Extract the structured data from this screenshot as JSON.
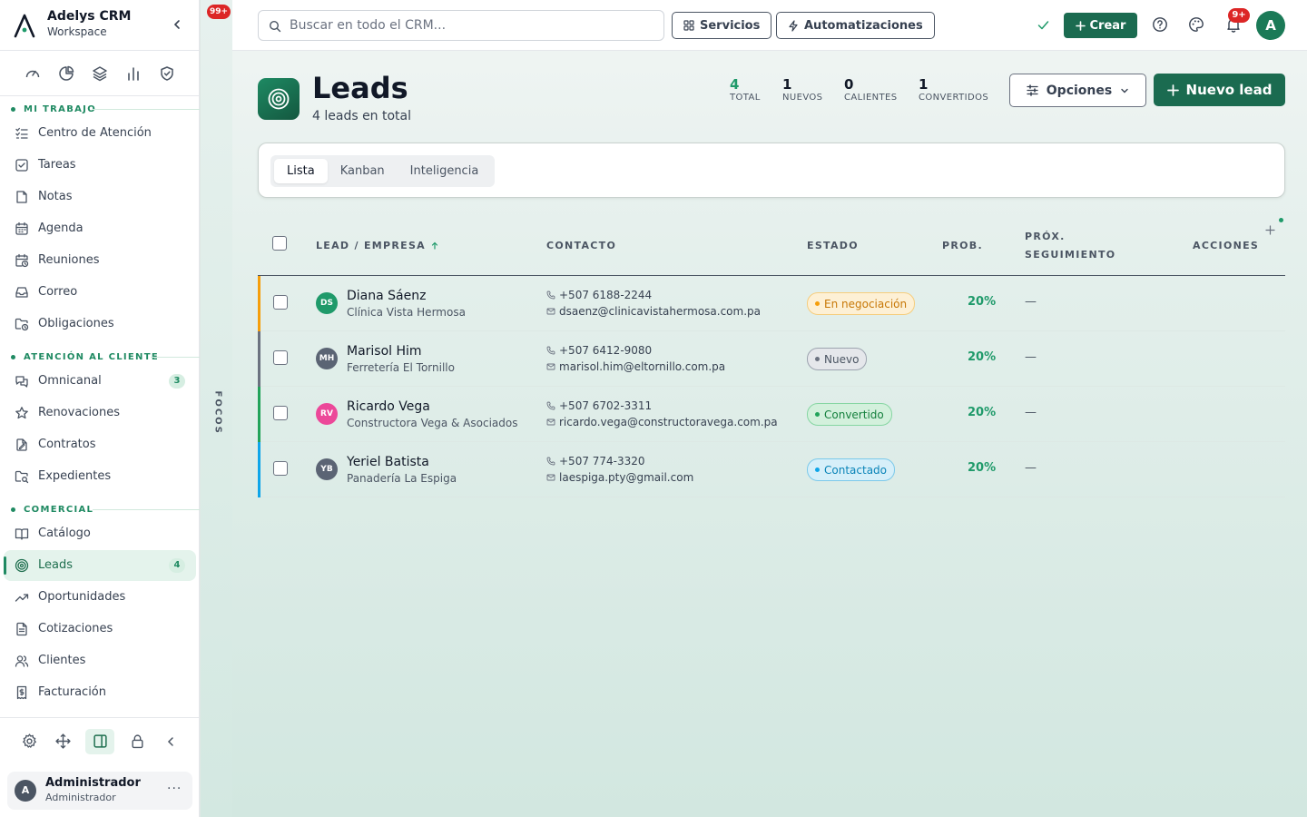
{
  "app": {
    "name": "Adelys CRM",
    "workspace": "Workspace"
  },
  "sidebar": {
    "quick_icons": [
      "dashboard-icon",
      "chart-pie-icon",
      "layers-icon",
      "bar-chart-icon",
      "shield-check-icon"
    ],
    "sections": [
      {
        "label": "MI TRABAJO"
      },
      {
        "label": "ATENCIÓN AL CLIENTE"
      },
      {
        "label": "COMERCIAL"
      }
    ],
    "items": [
      {
        "label": "Centro de Atención",
        "icon": "list-check-icon"
      },
      {
        "label": "Tareas",
        "icon": "checkbox-icon"
      },
      {
        "label": "Notas",
        "icon": "note-icon"
      },
      {
        "label": "Agenda",
        "icon": "calendar-icon"
      },
      {
        "label": "Reuniones",
        "icon": "calendar-clock-icon"
      },
      {
        "label": "Correo",
        "icon": "inbox-icon"
      },
      {
        "label": "Obligaciones",
        "icon": "folder-clock-icon"
      },
      {
        "label": "Omnicanal",
        "icon": "chat-icon",
        "count": "3"
      },
      {
        "label": "Renovaciones",
        "icon": "star-icon"
      },
      {
        "label": "Contratos",
        "icon": "contract-icon"
      },
      {
        "label": "Expedientes",
        "icon": "folder-search-icon"
      },
      {
        "label": "Catálogo",
        "icon": "book-icon"
      },
      {
        "label": "Leads",
        "icon": "target-icon",
        "count": "4",
        "active": true
      },
      {
        "label": "Oportunidades",
        "icon": "trending-up-icon"
      },
      {
        "label": "Cotizaciones",
        "icon": "document-icon"
      },
      {
        "label": "Clientes",
        "icon": "users-icon"
      },
      {
        "label": "Facturación",
        "icon": "invoice-icon"
      }
    ],
    "bottom_icons": [
      "gear-icon",
      "move-icon",
      "panel-icon",
      "lock-icon",
      "chevron-left-icon"
    ],
    "user": {
      "avatar": "A",
      "name": "Administrador",
      "role": "Administrador",
      "menu": "···"
    }
  },
  "focos": {
    "badge": "99+",
    "label": "FOCOS"
  },
  "topbar": {
    "search_placeholder": "Buscar en todo el CRM...",
    "servicios": "Servicios",
    "automatizaciones": "Automatizaciones",
    "crear": "Crear",
    "notif_badge": "9+",
    "avatar": "A"
  },
  "page": {
    "title": "Leads",
    "subtitle": "4 leads en total",
    "stats": [
      {
        "value": "4",
        "label": "TOTAL"
      },
      {
        "value": "1",
        "label": "NUEVOS"
      },
      {
        "value": "0",
        "label": "CALIENTES"
      },
      {
        "value": "1",
        "label": "CONVERTIDOS"
      }
    ],
    "opciones": "Opciones",
    "nuevo_lead": "Nuevo lead"
  },
  "views": {
    "tabs": [
      "Lista",
      "Kanban",
      "Inteligencia"
    ],
    "active": "Lista"
  },
  "table": {
    "columns": {
      "lead": "LEAD / EMPRESA",
      "contacto": "CONTACTO",
      "estado": "ESTADO",
      "prob": "PROB.",
      "prox_1": "PRÓX.",
      "prox_2": "SEGUIMIENTO",
      "acciones": "ACCIONES"
    },
    "rows": [
      {
        "initials": "DS",
        "name": "Diana Sáenz",
        "company": "Clínica Vista Hermosa",
        "phone": "+507 6188-2244",
        "email": "dsaenz@clinicavistahermosa.com.pa",
        "status": "En negociación",
        "prob": "20%",
        "next": "—"
      },
      {
        "initials": "MH",
        "name": "Marisol Him",
        "company": "Ferretería El Tornillo",
        "phone": "+507 6412-9080",
        "email": "marisol.him@eltornillo.com.pa",
        "status": "Nuevo",
        "prob": "20%",
        "next": "—"
      },
      {
        "initials": "RV",
        "name": "Ricardo Vega",
        "company": "Constructora Vega & Asociados",
        "phone": "+507 6702-3311",
        "email": "ricardo.vega@constructoravega.com.pa",
        "status": "Convertido",
        "prob": "20%",
        "next": "—"
      },
      {
        "initials": "YB",
        "name": "Yeriel Batista",
        "company": "Panadería La Espiga",
        "phone": "+507 774-3320",
        "email": "laespiga.pty@gmail.com",
        "status": "Contactado",
        "prob": "20%",
        "next": "—"
      }
    ]
  },
  "colors": {
    "brand": "#1b6b50",
    "accent": "#1f9a6a",
    "danger": "#dc2626",
    "status_negociacion": "#d97706",
    "status_nuevo": "#6b7280",
    "status_convertido": "#15803d",
    "status_contactado": "#0ea5e9"
  }
}
